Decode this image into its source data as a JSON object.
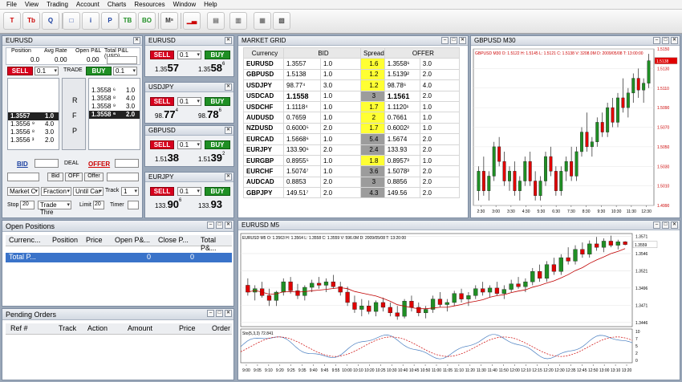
{
  "menu": [
    "File",
    "View",
    "Trading",
    "Account",
    "Charts",
    "Resources",
    "Window",
    "Help"
  ],
  "toolbar": [
    {
      "icon": "T-icon",
      "glyph": "T",
      "color": "#c00"
    },
    {
      "icon": "Tb-icon",
      "glyph": "Tb",
      "color": "#c00"
    },
    {
      "icon": "Q-icon",
      "glyph": "Q",
      "color": "#1a3fa0"
    },
    {
      "icon": "window-icon",
      "glyph": "□",
      "color": "#1a3fa0"
    },
    {
      "icon": "info-icon",
      "glyph": "i",
      "color": "#1a3fa0"
    },
    {
      "icon": "P-icon",
      "glyph": "P",
      "color": "#1a3fa0"
    },
    {
      "icon": "TB-icon",
      "glyph": "TB",
      "color": "#1f8f24"
    },
    {
      "icon": "BO-icon",
      "glyph": "BO",
      "color": "#1f8f24"
    },
    {
      "icon": "MS-icon",
      "glyph": "Mˢ",
      "color": "#333"
    },
    {
      "icon": "bar-chart-icon",
      "glyph": "▁▃",
      "color": "#c00"
    },
    {
      "icon": "panel-icon",
      "glyph": "▤",
      "color": "#777"
    },
    {
      "icon": "book-icon",
      "glyph": "▥",
      "color": "#777"
    },
    {
      "icon": "document-icon",
      "glyph": "▦",
      "color": "#777"
    },
    {
      "icon": "report-icon",
      "glyph": "▧",
      "color": "#555"
    }
  ],
  "dealer": {
    "title": "EURUSD",
    "cols": [
      "Position",
      "Avg Rate",
      "Open P&L",
      "Total P&L (USD)"
    ],
    "vals": [
      "0.0",
      "0.00",
      "0.00"
    ],
    "sell": "SELL",
    "buy": "BUY",
    "lot": "0.1",
    "trade": "TRADE",
    "bids": [
      {
        "p": "1.3557",
        "v": "1.0"
      },
      {
        "p": "1.3556 ⁹",
        "v": "4.0"
      },
      {
        "p": "1.3556 ⁸",
        "v": "3.0"
      },
      {
        "p": "1.3556 ³",
        "v": "2.0"
      }
    ],
    "offers": [
      {
        "p": "1.3558 ⁶",
        "v": "1.0"
      },
      {
        "p": "1.3558 ⁸",
        "v": "4.0"
      },
      {
        "p": "1.3558 ⁹",
        "v": "3.0"
      },
      {
        "p": "1.3558 ⁶",
        "v": "2.0"
      }
    ],
    "rfp": [
      "R",
      "F",
      "P"
    ],
    "bid": "BID",
    "deal": "DEAL",
    "offer": "OFFER",
    "small_bid": "Bid",
    "small_off": "OFF",
    "small_offer": "Offer",
    "sel1": "Market C",
    "sel2": "Fraction",
    "sel3": "Until Car",
    "track_label": "Track",
    "track_val": "1",
    "stop_label": "Stop",
    "stop_val": "20",
    "trade_thr": "Trade Thre",
    "limit_label": "Limit",
    "limit_val": "20",
    "timer_label": "Timer"
  },
  "tiles": [
    {
      "sym": "EURUSD",
      "sell": "SELL",
      "buy": "BUY",
      "lot": "0.1",
      "bid_pre": "1.35",
      "bid_big": "57",
      "bid_sup": "",
      "ask_pre": "1.35",
      "ask_big": "58",
      "ask_sup": "6"
    },
    {
      "sym": "USDJPY",
      "sell": "SELL",
      "buy": "BUY",
      "lot": "0.1",
      "bid_pre": "98.",
      "bid_big": "77",
      "bid_sup": "4",
      "ask_pre": "98.",
      "ask_big": "78",
      "ask_sup": "6"
    },
    {
      "sym": "GBPUSD",
      "sell": "SELL",
      "buy": "BUY",
      "lot": "0.1",
      "bid_pre": "1.51",
      "bid_big": "38",
      "bid_sup": "",
      "ask_pre": "1.51",
      "ask_big": "39",
      "ask_sup": "2"
    },
    {
      "sym": "EURJPY",
      "sell": "SELL",
      "buy": "BUY",
      "lot": "0.1",
      "bid_pre": "133.",
      "bid_big": "90",
      "bid_sup": "6",
      "ask_pre": "133.",
      "ask_big": "93",
      "ask_sup": ""
    }
  ],
  "grid": {
    "title": "MARKET GRID",
    "headers": [
      "Currency",
      "BID",
      "Spread",
      "OFFER"
    ],
    "rows": [
      {
        "c": "EURUSD",
        "b": "1.3557",
        "bv": "1.0",
        "s": "1.6",
        "sc": "yl",
        "o": "1.3558⁶",
        "ov": "3.0"
      },
      {
        "c": "GBPUSD",
        "b": "1.5138",
        "bv": "1.0",
        "s": "1.2",
        "sc": "yl",
        "o": "1.5139²",
        "ov": "2.0"
      },
      {
        "c": "USDJPY",
        "b": "98.77⁴",
        "bv": "3.0",
        "s": "1.2",
        "sc": "yl",
        "o": "98.78⁶",
        "ov": "4.0"
      },
      {
        "c": "USDCAD",
        "b": "1.1558",
        "bv": "1.0",
        "s": "3",
        "sc": "gy",
        "o": "1.1561",
        "ov": "2.0"
      },
      {
        "c": "USDCHF",
        "b": "1.1118⁴",
        "bv": "1.0",
        "s": "1.7",
        "sc": "yl",
        "o": "1.1120¹",
        "ov": "1.0"
      },
      {
        "c": "AUDUSD",
        "b": "0.7659",
        "bv": "1.0",
        "s": "2",
        "sc": "yl",
        "o": "0.7661",
        "ov": "1.0"
      },
      {
        "c": "NZDUSD",
        "b": "0.6000⁵",
        "bv": "2.0",
        "s": "1.7",
        "sc": "yl",
        "o": "0.6002²",
        "ov": "1.0"
      },
      {
        "c": "EURCAD",
        "b": "1.5668⁶",
        "bv": "1.0",
        "s": "5.4",
        "sc": "gy",
        "o": "1.5674",
        "ov": "2.0"
      },
      {
        "c": "EURJPY",
        "b": "133.90⁶",
        "bv": "2.0",
        "s": "2.4",
        "sc": "gy",
        "o": "133.93",
        "ov": "2.0"
      },
      {
        "c": "EURGBP",
        "b": "0.8955⁵",
        "bv": "1.0",
        "s": "1.8",
        "sc": "yl",
        "o": "0.8957³",
        "ov": "1.0"
      },
      {
        "c": "EURCHF",
        "b": "1.5074⁷",
        "bv": "1.0",
        "s": "3.6",
        "sc": "gy",
        "o": "1.5078³",
        "ov": "2.0"
      },
      {
        "c": "AUDCAD",
        "b": "0.8853",
        "bv": "2.0",
        "s": "3",
        "sc": "gy",
        "o": "0.8856",
        "ov": "2.0"
      },
      {
        "c": "GBPJPY",
        "b": "149.51⁷",
        "bv": "2.0",
        "s": "4.3",
        "sc": "gy",
        "o": "149.56",
        "ov": "2.0"
      }
    ]
  },
  "open_positions": {
    "title": "Open Positions",
    "headers": [
      "Currenc...",
      "Position",
      "Price",
      "Open P&...",
      "Close P...",
      "Total P&..."
    ],
    "total_row": [
      "Total P...",
      "0",
      "0"
    ]
  },
  "pending_orders": {
    "title": "Pending Orders",
    "headers": [
      "Ref #",
      "Track",
      "Action",
      "Amount",
      "Price",
      "Order"
    ]
  },
  "chart_data": [
    {
      "type": "candlestick",
      "title": "GBPUSD M30",
      "info": "GBPUSD M30 O: 1.5122 H: 1.5145 L: 1.5121 C: 1.5138 V: 3208.0M D: 2009/05/08 T: 13:00:00",
      "yticks": [
        "1.5150",
        "1.5130",
        "1.5110",
        "1.5090",
        "1.5070",
        "1.5050",
        "1.5030",
        "1.5010",
        "1.4990"
      ],
      "ylim": [
        1.499,
        1.515
      ],
      "last": "1.5138",
      "xticks": [
        "2:30",
        "3:00",
        "3:30",
        "4:30",
        "5:30",
        "6:30",
        "7:30",
        "8:30",
        "9:30",
        "10:30",
        "11:30",
        "12:30"
      ],
      "candles": [
        [
          1.5005,
          1.503,
          1.4995,
          1.5025
        ],
        [
          1.5025,
          1.504,
          1.5,
          1.5005
        ],
        [
          1.5005,
          1.5025,
          1.4995,
          1.502
        ],
        [
          1.502,
          1.5055,
          1.5015,
          1.505
        ],
        [
          1.505,
          1.506,
          1.503,
          1.5035
        ],
        [
          1.5035,
          1.5045,
          1.501,
          1.5015
        ],
        [
          1.5015,
          1.503,
          1.5005,
          1.5025
        ],
        [
          1.5025,
          1.5035,
          1.5,
          1.5005
        ],
        [
          1.5005,
          1.502,
          1.4995,
          1.5015
        ],
        [
          1.5015,
          1.504,
          1.501,
          1.5035
        ],
        [
          1.5035,
          1.5045,
          1.501,
          1.5015
        ],
        [
          1.5015,
          1.5025,
          1.4995,
          1.5
        ],
        [
          1.5,
          1.502,
          1.4995,
          1.5015
        ],
        [
          1.5015,
          1.5045,
          1.501,
          1.504
        ],
        [
          1.504,
          1.505,
          1.502,
          1.5025
        ],
        [
          1.5025,
          1.503,
          1.5,
          1.5005
        ],
        [
          1.5005,
          1.503,
          1.5,
          1.5025
        ],
        [
          1.5025,
          1.504,
          1.5015,
          1.5035
        ],
        [
          1.5035,
          1.505,
          1.5015,
          1.502
        ],
        [
          1.502,
          1.505,
          1.5015,
          1.5045
        ],
        [
          1.5045,
          1.507,
          1.504,
          1.5065
        ],
        [
          1.5065,
          1.5085,
          1.5045,
          1.505
        ],
        [
          1.505,
          1.506,
          1.504,
          1.5055
        ],
        [
          1.5055,
          1.508,
          1.505,
          1.5075
        ],
        [
          1.5075,
          1.5085,
          1.506,
          1.5065
        ],
        [
          1.5065,
          1.5095,
          1.506,
          1.509
        ],
        [
          1.509,
          1.51,
          1.507,
          1.5075
        ],
        [
          1.5075,
          1.5105,
          1.507,
          1.51
        ],
        [
          1.51,
          1.512,
          1.5085,
          1.509
        ],
        [
          1.509,
          1.511,
          1.508,
          1.5105
        ],
        [
          1.5105,
          1.5125,
          1.5095,
          1.512
        ],
        [
          1.512,
          1.513,
          1.51,
          1.5108
        ],
        [
          1.5108,
          1.512,
          1.5095,
          1.5115
        ],
        [
          1.5115,
          1.5145,
          1.511,
          1.5138
        ]
      ]
    },
    {
      "type": "candlestick",
      "title": "EURUSD M5",
      "info": "EURUSD M5 O: 1.3563 H: 1.3564 L: 1.3558 C: 1.3559 V: 596.0M D: 2009/05/08 T: 13:20:00",
      "yticks": [
        "1.3571",
        "1.3546",
        "1.3521",
        "1.3496",
        "1.3471",
        "1.3446"
      ],
      "ylim": [
        1.344,
        1.3575
      ],
      "last": "1.3559",
      "xticks": [
        "9:00",
        "9:05",
        "9:10",
        "9:20",
        "9:25",
        "9:35",
        "9:40",
        "9:45",
        "9:55",
        "10:00",
        "10:10",
        "10:20",
        "10:25",
        "10:30",
        "10:40",
        "10:45",
        "10:50",
        "11:00",
        "11:05",
        "11:10",
        "11:20",
        "11:30",
        "11:40",
        "11:50",
        "12:00",
        "12:10",
        "12:15",
        "12:20",
        "12:30",
        "12:35",
        "12:45",
        "12:50",
        "13:00",
        "13:10",
        "13:20"
      ],
      "candles": [
        [
          1.35,
          1.351,
          1.3485,
          1.349
        ],
        [
          1.349,
          1.35,
          1.3478,
          1.3495
        ],
        [
          1.3495,
          1.3505,
          1.3482,
          1.3485
        ],
        [
          1.3485,
          1.3495,
          1.347,
          1.3478
        ],
        [
          1.3478,
          1.3492,
          1.347,
          1.349
        ],
        [
          1.349,
          1.351,
          1.3485,
          1.3505
        ],
        [
          1.3505,
          1.3512,
          1.3488,
          1.3492
        ],
        [
          1.3492,
          1.3502,
          1.348,
          1.3485
        ],
        [
          1.3485,
          1.35,
          1.3478,
          1.3497
        ],
        [
          1.3497,
          1.3508,
          1.349,
          1.3503
        ],
        [
          1.3503,
          1.3512,
          1.3495,
          1.35
        ],
        [
          1.35,
          1.351,
          1.349,
          1.3505
        ],
        [
          1.3505,
          1.3515,
          1.3495,
          1.3498
        ],
        [
          1.3498,
          1.3505,
          1.3485,
          1.349
        ],
        [
          1.349,
          1.3498,
          1.347,
          1.3475
        ],
        [
          1.3475,
          1.3485,
          1.346,
          1.3465
        ],
        [
          1.3465,
          1.348,
          1.3455,
          1.347
        ],
        [
          1.347,
          1.3478,
          1.3458,
          1.3462
        ],
        [
          1.3462,
          1.3478,
          1.3455,
          1.3475
        ],
        [
          1.3475,
          1.3482,
          1.3462,
          1.3468
        ],
        [
          1.3468,
          1.3475,
          1.3455,
          1.346
        ],
        [
          1.346,
          1.347,
          1.345,
          1.3455
        ],
        [
          1.3455,
          1.348,
          1.3452,
          1.3477
        ],
        [
          1.3477,
          1.3485,
          1.3462,
          1.3468
        ],
        [
          1.3468,
          1.3475,
          1.3455,
          1.346
        ],
        [
          1.346,
          1.347,
          1.3452,
          1.3465
        ],
        [
          1.3465,
          1.3485,
          1.346,
          1.348
        ],
        [
          1.348,
          1.349,
          1.3468,
          1.3472
        ],
        [
          1.3472,
          1.348,
          1.3462,
          1.3475
        ],
        [
          1.3475,
          1.3492,
          1.347,
          1.3488
        ],
        [
          1.3488,
          1.3495,
          1.3475,
          1.348
        ],
        [
          1.348,
          1.349,
          1.347,
          1.3485
        ],
        [
          1.3485,
          1.35,
          1.348,
          1.3495
        ],
        [
          1.3495,
          1.3505,
          1.3485,
          1.349
        ],
        [
          1.349,
          1.35,
          1.3482,
          1.3496
        ],
        [
          1.3496,
          1.3505,
          1.3485,
          1.3488
        ],
        [
          1.3488,
          1.35,
          1.348,
          1.3494
        ],
        [
          1.3494,
          1.3508,
          1.349,
          1.3502
        ],
        [
          1.3502,
          1.3512,
          1.3495,
          1.3498
        ],
        [
          1.3498,
          1.351,
          1.349,
          1.3505
        ],
        [
          1.3505,
          1.3525,
          1.35,
          1.352
        ],
        [
          1.352,
          1.353,
          1.3505,
          1.351
        ],
        [
          1.351,
          1.3535,
          1.3505,
          1.353
        ],
        [
          1.353,
          1.354,
          1.3515,
          1.352
        ],
        [
          1.352,
          1.3545,
          1.3515,
          1.354
        ],
        [
          1.354,
          1.3555,
          1.353,
          1.3535
        ],
        [
          1.3535,
          1.3558,
          1.353,
          1.3552
        ],
        [
          1.3552,
          1.3562,
          1.354,
          1.3545
        ],
        [
          1.3545,
          1.3565,
          1.354,
          1.356
        ],
        [
          1.356,
          1.357,
          1.355,
          1.3555
        ],
        [
          1.3555,
          1.3568,
          1.3548,
          1.3564
        ],
        [
          1.3564,
          1.3572,
          1.3555,
          1.3558
        ],
        [
          1.3558,
          1.3566,
          1.3552,
          1.3563
        ],
        [
          1.3563,
          1.3564,
          1.3558,
          1.3559
        ]
      ],
      "ma_note": "red moving average line",
      "stoch": {
        "label": "Sto(5,3,3)",
        "value": "72.841",
        "yticks": [
          "10",
          "7",
          "5",
          "2",
          "0"
        ]
      }
    }
  ]
}
